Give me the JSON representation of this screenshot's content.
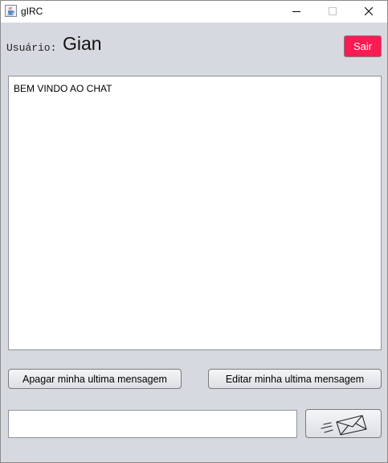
{
  "window": {
    "title": "gIRC",
    "icon": "java-cup-icon",
    "controls": [
      "minimize-icon",
      "maximize-icon",
      "close-icon"
    ]
  },
  "header": {
    "user_label": "Usuário:",
    "user_name": "Gian",
    "logout_label": "Sair",
    "logout_color": "#fc1a52"
  },
  "chat": {
    "messages": [
      "BEM VINDO AO CHAT"
    ]
  },
  "actions": {
    "delete_label": "Apagar minha ultima mensagem",
    "edit_label": "Editar minha ultima mensagem"
  },
  "composer": {
    "input_value": "",
    "send_icon": "envelope-send-icon"
  },
  "colors": {
    "background": "#d6d9df",
    "titlebar": "#ffffff",
    "chat_background": "#ffffff"
  }
}
